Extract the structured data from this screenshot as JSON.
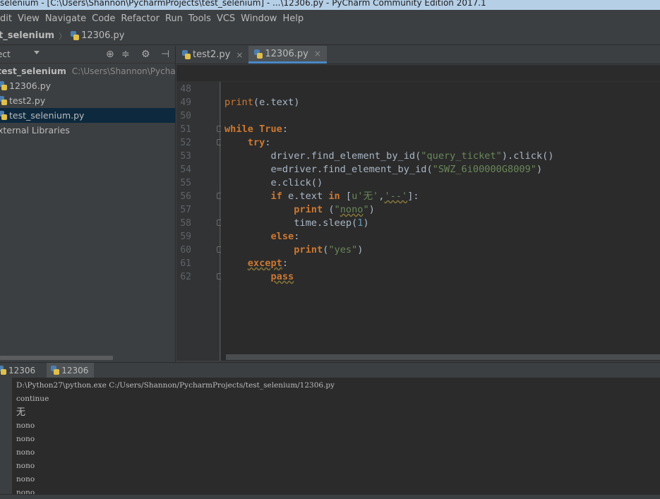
{
  "window": {
    "title": "selenium - [C:\\Users\\Shannon\\PycharmProjects\\test_selenium] - ...\\12306.py - PyCharm Community Edition 2017.1"
  },
  "menu": [
    "dit",
    "View",
    "Navigate",
    "Code",
    "Refactor",
    "Run",
    "Tools",
    "VCS",
    "Window",
    "Help"
  ],
  "breadcrumb": {
    "project": "t_selenium",
    "file": "12306.py"
  },
  "project_panel": {
    "header": "ect",
    "root_name": "test_selenium",
    "root_path": "C:\\Users\\Shannon\\PycharmP",
    "files": [
      "12306.py",
      "test2.py",
      "test_selenium.py"
    ],
    "external": "xternal Libraries"
  },
  "editor": {
    "tabs": [
      {
        "label": "test2.py",
        "active": false
      },
      {
        "label": "12306.py",
        "active": true
      }
    ],
    "line_numbers": [
      "48",
      "49",
      "50",
      "51",
      "52",
      "53",
      "54",
      "55",
      "56",
      "57",
      "58",
      "59",
      "60",
      "61",
      "62"
    ]
  },
  "run_panel": {
    "tabs": [
      "12306",
      "12306"
    ],
    "console": [
      "D:\\Python27\\python.exe C:/Users/Shannon/PycharmProjects/test_selenium/12306.py",
      "continue",
      "无",
      "nono",
      "nono",
      "nono",
      "nono",
      "nono",
      "nono"
    ]
  },
  "colors": {
    "editor_bg": "#2b2b2b",
    "panel_bg": "#3c3f41",
    "keyword": "#cc7832",
    "string": "#6a8759",
    "number": "#6897bb",
    "selection": "#0d293e"
  }
}
